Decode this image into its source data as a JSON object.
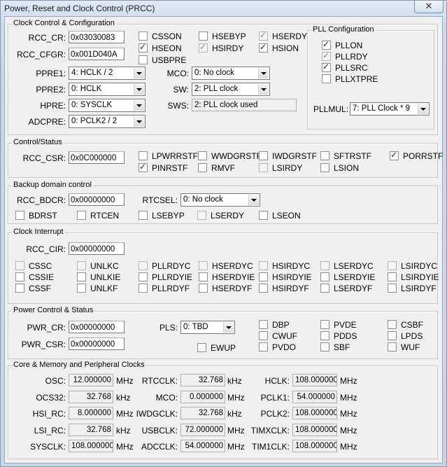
{
  "window": {
    "title": "Power, Reset and Clock Control (PRCC)",
    "close_label": "✕"
  },
  "clock_config": {
    "title": "Clock Control & Configuration",
    "rcc_cr_label": "RCC_CR:",
    "rcc_cr": "0x03030083",
    "rcc_cfgr_label": "RCC_CFGR:",
    "rcc_cfgr": "0x001D040A",
    "checkboxes": [
      {
        "label": "CSSON",
        "checked": false,
        "disabled": false
      },
      {
        "label": "HSEBYP",
        "checked": false,
        "disabled": false
      },
      {
        "label": "HSERDY",
        "checked": true,
        "disabled": true
      },
      {
        "label": "HSEON",
        "checked": true,
        "disabled": false
      },
      {
        "label": "HSIRDY",
        "checked": true,
        "disabled": true
      },
      {
        "label": "HSION",
        "checked": true,
        "disabled": false
      },
      {
        "label": "USBPRE",
        "checked": false,
        "disabled": false
      }
    ],
    "ppre1_label": "PPRE1:",
    "ppre1": "4: HCLK / 2",
    "ppre2_label": "PPRE2:",
    "ppre2": "0: HCLK",
    "hpre_label": "HPRE:",
    "hpre": "0: SYSCLK",
    "adcpre_label": "ADCPRE:",
    "adcpre": "0: PCLK2 / 2",
    "mco_label": "MCO:",
    "mco": "0: No clock",
    "sw_label": "SW:",
    "sw": "2: PLL clock",
    "sws_label": "SWS:",
    "sws": "2: PLL clock used",
    "pll": {
      "title": "PLL Configuration",
      "checkboxes": [
        {
          "label": "PLLON",
          "checked": true,
          "disabled": false
        },
        {
          "label": "PLLRDY",
          "checked": true,
          "disabled": true
        },
        {
          "label": "PLLSRC",
          "checked": true,
          "disabled": false
        },
        {
          "label": "PLLXTPRE",
          "checked": false,
          "disabled": false
        }
      ],
      "pllmul_label": "PLLMUL:",
      "pllmul": "7: PLL Clock * 9"
    }
  },
  "control_status": {
    "title": "Control/Status",
    "rcc_csr_label": "RCC_CSR:",
    "rcc_csr": "0x0C000000",
    "checkboxes": [
      {
        "label": "LPWRRSTF",
        "checked": false,
        "disabled": false
      },
      {
        "label": "WWDGRSTF",
        "checked": false,
        "disabled": false
      },
      {
        "label": "IWDGRSTF",
        "checked": false,
        "disabled": false
      },
      {
        "label": "SFTRSTF",
        "checked": false,
        "disabled": false
      },
      {
        "label": "PORRSTF",
        "checked": true,
        "disabled": false
      },
      {
        "label": "PINRSTF",
        "checked": true,
        "disabled": false
      },
      {
        "label": "RMVF",
        "checked": false,
        "disabled": false
      },
      {
        "label": "LSIRDY",
        "checked": false,
        "disabled": true
      },
      {
        "label": "LSION",
        "checked": false,
        "disabled": false
      }
    ]
  },
  "backup": {
    "title": "Backup domain control",
    "rcc_bdcr_label": "RCC_BDCR:",
    "rcc_bdcr": "0x00000000",
    "rtcsel_label": "RTCSEL:",
    "rtcsel": "0: No clock",
    "checkboxes": [
      {
        "label": "BDRST",
        "checked": false,
        "disabled": false
      },
      {
        "label": "RTCEN",
        "checked": false,
        "disabled": false
      },
      {
        "label": "LSEBYP",
        "checked": false,
        "disabled": false
      },
      {
        "label": "LSERDY",
        "checked": false,
        "disabled": true
      },
      {
        "label": "LSEON",
        "checked": false,
        "disabled": false
      }
    ]
  },
  "clock_interrupt": {
    "title": "Clock Interrupt",
    "rcc_cir_label": "RCC_CIR:",
    "rcc_cir": "0x00000000",
    "row1": [
      "CSSC",
      "UNLKC",
      "PLLRDYC",
      "HSERDYC",
      "HSIRDYC",
      "LSERDYC",
      "LSIRDYC"
    ],
    "row2": [
      "CSSIE",
      "UNLKIE",
      "PLLRDYIE",
      "HSERDYIE",
      "HSIRDYIE",
      "LSERDYIE",
      "LSIRDYIE"
    ],
    "row3": [
      "CSSF",
      "UNLKF",
      "PLLRDYF",
      "HSERDYF",
      "HSIRDYF",
      "LSERDYF",
      "LSIRDYF"
    ]
  },
  "power": {
    "title": "Power Control & Status",
    "pwr_cr_label": "PWR_CR:",
    "pwr_cr": "0x00000000",
    "pwr_csr_label": "PWR_CSR:",
    "pwr_csr": "0x00000000",
    "pls_label": "PLS:",
    "pls": "0: TBD",
    "ewup": "EWUP",
    "col1": [
      "DBP",
      "CWUF",
      "PVDO"
    ],
    "col2": [
      "PVDE",
      "PDDS",
      "SBF"
    ],
    "col3": [
      "CSBF",
      "LPDS",
      "WUF"
    ]
  },
  "clocks": {
    "title": "Core & Memory and Peripheral Clocks",
    "col1": [
      {
        "label": "OSC:",
        "value": "12.000000",
        "unit": "MHz"
      },
      {
        "label": "OCS32:",
        "value": "32.768",
        "unit": "kHz"
      },
      {
        "label": "HSI_RC:",
        "value": "8.000000",
        "unit": "MHz"
      },
      {
        "label": "LSI_RC:",
        "value": "32.768",
        "unit": "kHz"
      },
      {
        "label": "SYSCLK:",
        "value": "108.000000",
        "unit": "MHz"
      }
    ],
    "col2": [
      {
        "label": "RTCCLK:",
        "value": "32.768",
        "unit": "kHz"
      },
      {
        "label": "MCO:",
        "value": "0.000000",
        "unit": "MHz"
      },
      {
        "label": "IWDGCLK:",
        "value": "32.768",
        "unit": "kHz"
      },
      {
        "label": "USBCLK:",
        "value": "72.000000",
        "unit": "MHz"
      },
      {
        "label": "ADCCLK:",
        "value": "54.000000",
        "unit": "MHz"
      }
    ],
    "col3": [
      {
        "label": "HCLK:",
        "value": "108.000000",
        "unit": "MHz"
      },
      {
        "label": "PCLK1:",
        "value": "54.000000",
        "unit": "MHz"
      },
      {
        "label": "PCLK2:",
        "value": "108.000000",
        "unit": "MHz"
      },
      {
        "label": "TIMXCLK:",
        "value": "108.000000",
        "unit": "MHz"
      },
      {
        "label": "TIM1CLK:",
        "value": "108.000000",
        "unit": "MHz"
      }
    ]
  }
}
